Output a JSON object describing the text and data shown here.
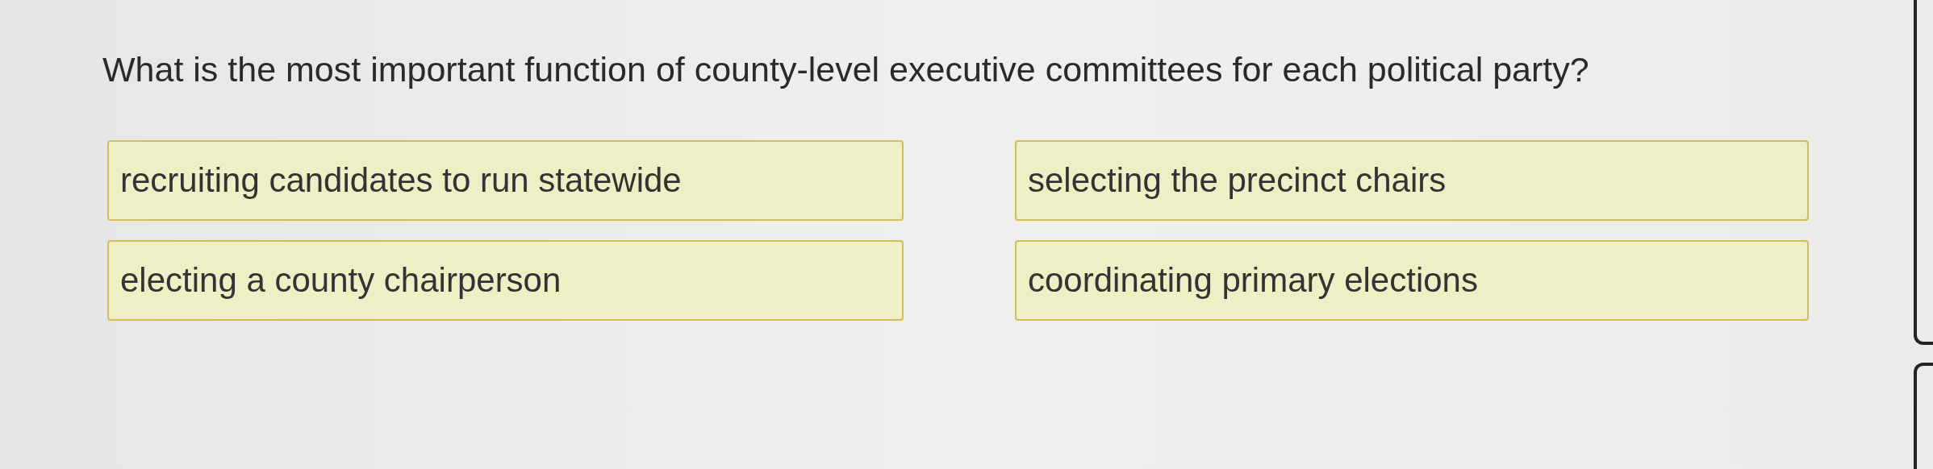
{
  "question": "What is the most important function of county-level executive committees for each political party?",
  "options": [
    {
      "label": "recruiting candidates to run statewide"
    },
    {
      "label": "selecting the precinct chairs"
    },
    {
      "label": "electing a county chairperson"
    },
    {
      "label": "coordinating primary elections"
    }
  ]
}
